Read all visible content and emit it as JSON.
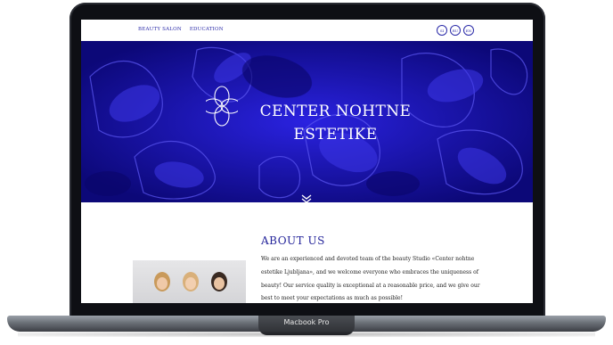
{
  "device": {
    "label": "Macbook Pro"
  },
  "header": {
    "nav": [
      {
        "label": "BEAUTY SALON"
      },
      {
        "label": "EDUCATION"
      }
    ],
    "languages": [
      "SI",
      "RU",
      "EN"
    ]
  },
  "hero": {
    "title_line1": "CENTER NOHTNE",
    "title_line2": "ESTETIKE",
    "icons": {
      "logo": "flower-logo-icon",
      "scroll": "chevron-double-down-icon"
    },
    "colors": {
      "background": "#1a12c9",
      "text": "#ffffff"
    }
  },
  "about": {
    "title": "ABOUT US",
    "text": "We are an experienced and devoted team of the beauty Studio «Center nohtne estetike Ljubljana», and we welcome everyone who embraces the uniqueness of beauty! Our service quality is exceptional at a reasonable price, and we give our best to meet your expectations as much as possible!",
    "accent_color": "#24249a"
  }
}
